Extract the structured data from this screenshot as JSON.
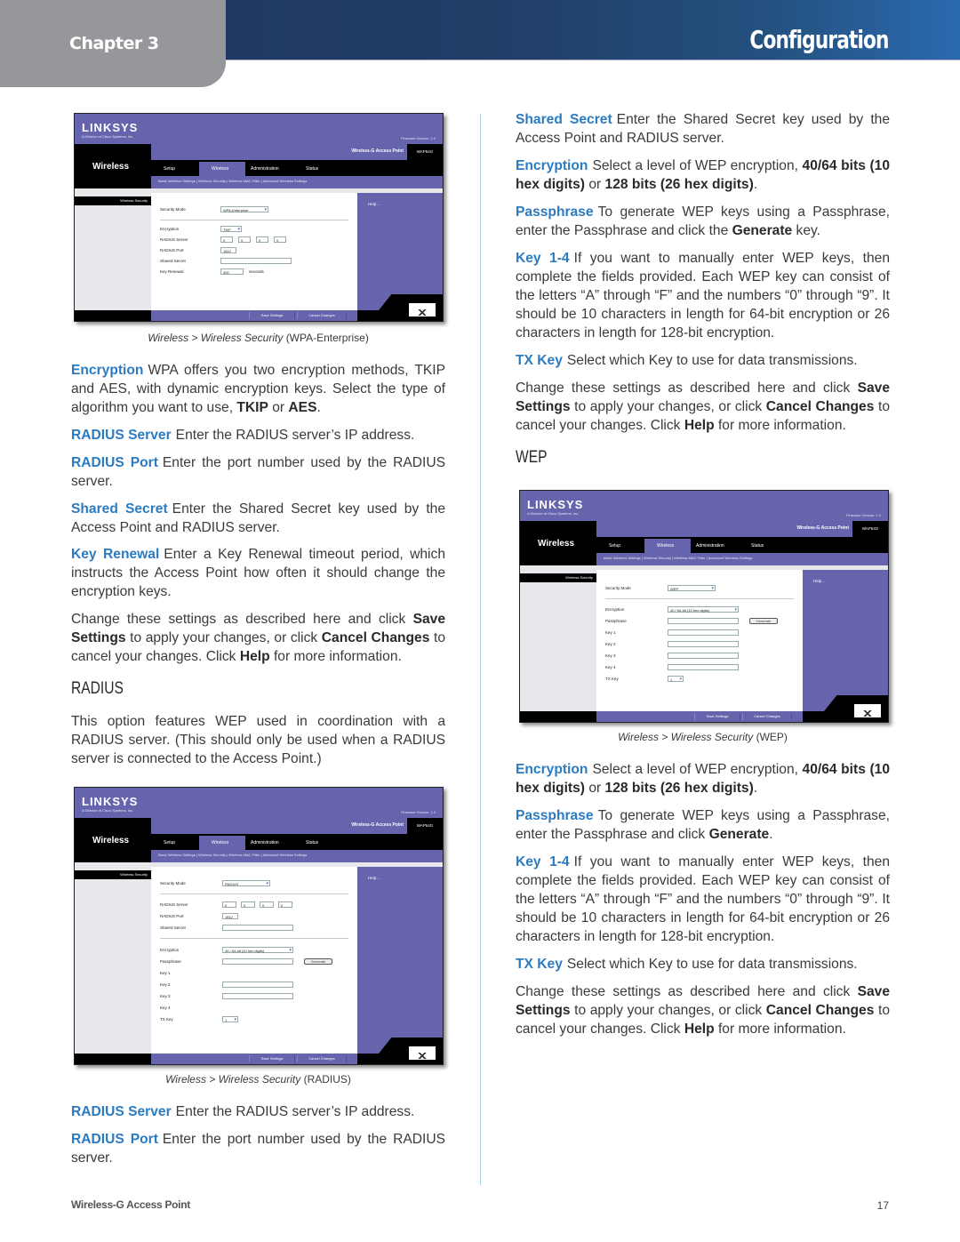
{
  "header": {
    "chapter": "Chapter 3",
    "title": "Configuration"
  },
  "colors": {
    "header_bar": "#1d3560",
    "chapter_tab": "#96979a",
    "term_blue": "#2b7bc2",
    "ui_purple": "#6664ad"
  },
  "left_column": {
    "shot_wpa": {
      "logo": "LINKSYS",
      "logo_sub": "A Division of Cisco Systems, Inc.",
      "firmware": "Firmware Version: 1.0",
      "section": "Wireless",
      "product": "Wireless-G Access Point",
      "model": "WAP54G",
      "tabs": [
        "Setup",
        "Wireless",
        "Administration",
        "Status"
      ],
      "subtabs": "Basic Wireless Settings  |  Wireless Security  |  Wireless MAC Filter  |  Advanced Wireless Settings",
      "side_item": "Wireless Security",
      "help": "Help...",
      "fields": {
        "security_mode_label": "Security Mode",
        "security_mode_value": "WPA-Enterprise",
        "encryption_label": "Encryption",
        "encryption_value": "TKIP",
        "radius_server_label": "RADIUS Server",
        "radius_server_octets": [
          "0",
          "0",
          "0",
          "0"
        ],
        "radius_port_label": "RADIUS Port",
        "radius_port_value": "1812",
        "shared_secret_label": "Shared Secret",
        "shared_secret_value": "",
        "key_renewal_label": "Key Renewal",
        "key_renewal_value": "300",
        "key_renewal_unit": "seconds"
      },
      "save_button": "Save Settings",
      "cancel_button": "Cancel Changes",
      "cisco": "Cisco Systems"
    },
    "caption_wpa": {
      "path": "Wireless > Wireless Security",
      "mode": "(WPA-Enterprise)"
    },
    "paragraphs": {
      "encryption": {
        "term": "Encryption",
        "text_1": "WPA offers you two encryption methods, TKIP and AES, with dynamic encryption keys. Select the type of algorithm you want to use, ",
        "bold_1": "TKIP",
        "text_2": " or ",
        "bold_2": "AES",
        "text_3": "."
      },
      "radius_server": {
        "term": "RADIUS Server",
        "text": "Enter the RADIUS server’s IP address."
      },
      "radius_port": {
        "term": "RADIUS Port",
        "text": "Enter the port number used by the RADIUS server."
      },
      "shared_secret": {
        "term": "Shared Secret",
        "text": "Enter the Shared Secret key used by the Access Point and RADIUS server."
      },
      "key_renewal": {
        "term": "Key Renewal",
        "text": "Enter a Key Renewal timeout period, which instructs the Access Point how often it should change the encryption keys."
      },
      "change": {
        "text_1": "Change these settings as described here and click ",
        "bold_1": "Save Settings",
        "text_2": " to apply your changes, or click ",
        "bold_2": "Cancel Changes",
        "text_3": " to cancel your changes. Click ",
        "bold_3": "Help",
        "text_4": " for more information."
      }
    },
    "radius_heading": "RADIUS",
    "radius_intro": "This option features WEP used in coordination with a RADIUS server. (This should only be used when a RADIUS server is connected to the Access Point.)",
    "shot_radius": {
      "fields": {
        "security_mode_label": "Security Mode",
        "security_mode_value": "RADIUS",
        "radius_server_label": "RADIUS Server",
        "radius_server_octets": [
          "0",
          "0",
          "0",
          "0"
        ],
        "radius_port_label": "RADIUS Port",
        "radius_port_value": "1812",
        "shared_secret_label": "Shared Secret",
        "encryption_label": "Encryption",
        "encryption_value": "40 / 64-bit (10 hex digits)",
        "passphrase_label": "Passphrase",
        "generate_button": "Generate",
        "key_labels": [
          "Key 1",
          "Key 2",
          "Key 3",
          "Key 4"
        ],
        "tx_key_label": "TX Key",
        "tx_key_value": "1"
      }
    },
    "caption_radius": {
      "path": "Wireless > Wireless Security",
      "mode": "(RADIUS)"
    },
    "paragraphs_2": {
      "radius_server": {
        "term": "RADIUS Server",
        "text": "Enter the RADIUS server’s IP address."
      },
      "radius_port": {
        "term": "RADIUS Port",
        "text": "Enter the port number used by the RADIUS server."
      }
    }
  },
  "right_column": {
    "paragraphs": {
      "shared_secret": {
        "term": "Shared Secret",
        "text": "Enter the Shared Secret key used by the Access Point and RADIUS server."
      },
      "encryption": {
        "term": "Encryption",
        "text_1": "Select a level of WEP encryption, ",
        "bold_1": "40/64 bits (10 hex digits)",
        "text_2": " or ",
        "bold_2": "128 bits (26 hex digits)",
        "text_3": "."
      },
      "passphrase": {
        "term": "Passphrase",
        "text_1": "To generate WEP keys using a Passphrase, enter the Passphrase and click the ",
        "bold_1": "Generate",
        "text_2": " key."
      },
      "keys": {
        "term": "Key 1-4",
        "text": "If you want to manually enter WEP keys, then complete the fields provided. Each WEP key can consist of the letters “A” through “F” and the numbers “0” through “9”. It should be 10 characters in length for 64-bit encryption or 26 characters in length for 128-bit encryption."
      },
      "tx_key": {
        "term": "TX Key",
        "text": "Select which Key to use for data transmissions."
      },
      "change": {
        "text_1": "Change these settings as described here and click ",
        "bold_1": "Save Settings",
        "text_2": " to apply your changes, or click ",
        "bold_2": "Cancel Changes",
        "text_3": " to cancel your changes. Click ",
        "bold_3": "Help",
        "text_4": " for more information."
      }
    },
    "wep_heading": "WEP",
    "shot_wep": {
      "fields": {
        "security_mode_label": "Security Mode",
        "security_mode_value": "WEP",
        "encryption_label": "Encryption",
        "encryption_value": "40 / 64-bit (10 hex digits)",
        "passphrase_label": "Passphrase",
        "generate_button": "Generate",
        "key_labels": [
          "Key 1",
          "Key 2",
          "Key 3",
          "Key 4"
        ],
        "tx_key_label": "TX Key",
        "tx_key_value": "1"
      }
    },
    "caption_wep": {
      "path": "Wireless > Wireless Security",
      "mode": "(WEP)"
    },
    "paragraphs_2": {
      "encryption": {
        "term": "Encryption",
        "text_1": "Select a level of WEP encryption, ",
        "bold_1": "40/64 bits (10 hex digits)",
        "text_2": " or ",
        "bold_2": "128 bits (26 hex digits)",
        "text_3": "."
      },
      "passphrase": {
        "term": "Passphrase",
        "text_1": "To generate WEP keys using a Passphrase, enter the Passphrase and click ",
        "bold_1": "Generate",
        "text_2": "."
      },
      "keys": {
        "term": "Key 1-4",
        "text": "If you want to manually enter WEP keys, then complete the fields provided. Each WEP key can consist of the letters “A” through “F” and the numbers “0” through “9”. It should be 10 characters in length for 64-bit encryption or 26 characters in length for 128-bit encryption."
      },
      "tx_key": {
        "term": "TX Key",
        "text": "Select which Key to use for data transmissions."
      },
      "change": {
        "text_1": "Change these settings as described here and click ",
        "bold_1": "Save Settings",
        "text_2": " to apply your changes, or click ",
        "bold_2": "Cancel Changes",
        "text_3": " to cancel your changes. Click ",
        "bold_3": "Help",
        "text_4": " for more information."
      }
    }
  },
  "footer": {
    "product": "Wireless-G Access Point",
    "page_number": "17"
  }
}
